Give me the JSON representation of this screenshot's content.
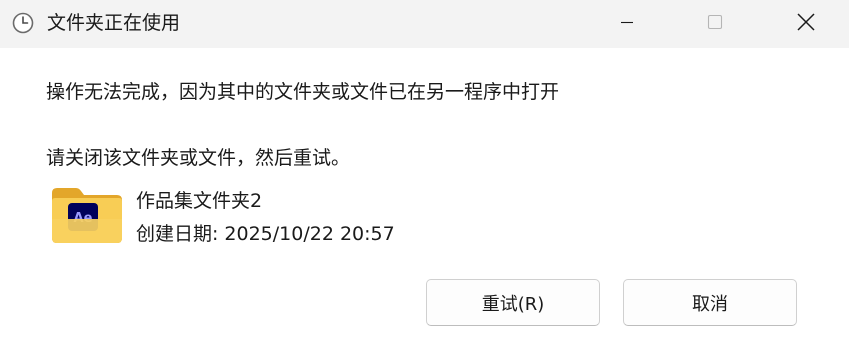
{
  "window": {
    "title": "文件夹正在使用",
    "title_icon": "clock-icon",
    "controls": {
      "minimize_icon": "minimize-icon",
      "maximize_icon": "maximize-icon",
      "close_icon": "close-icon"
    }
  },
  "message": {
    "line1": "操作无法完成，因为其中的文件夹或文件已在另一程序中打开",
    "line2": "请关闭该文件夹或文件，然后重试。"
  },
  "file": {
    "icon": "ae-folder-icon",
    "icon_badge": "Ae",
    "name": "作品集文件夹2",
    "created_label": "创建日期:",
    "created_value": "2025/10/22 20:57"
  },
  "buttons": {
    "retry": "重试(R)",
    "cancel": "取消"
  },
  "colors": {
    "titlebar_bg": "#f3f3f3",
    "folder_yellow": "#f5c242",
    "ae_badge_bg": "#00005b",
    "ae_badge_text": "#9999ff"
  }
}
